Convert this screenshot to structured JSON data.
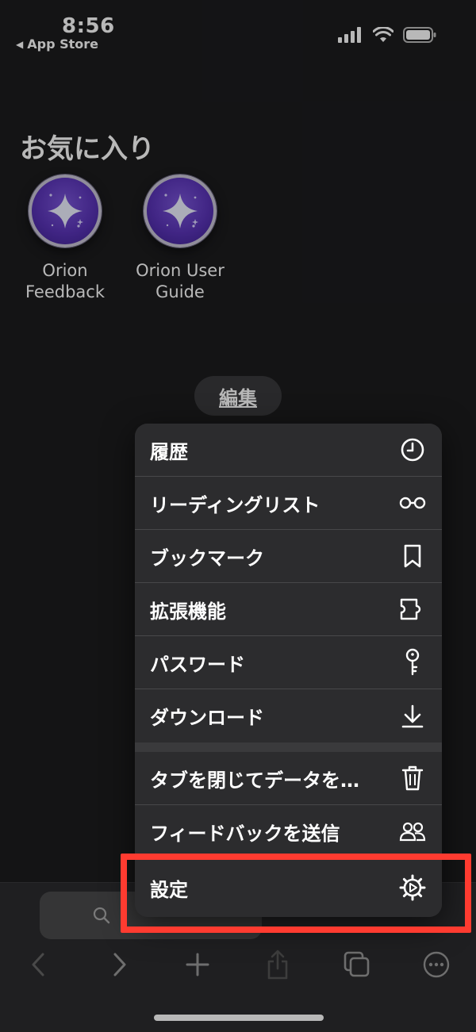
{
  "status": {
    "time": "8:56",
    "back_app": "App Store"
  },
  "favorites": {
    "title": "お気に入り",
    "items": [
      {
        "line1": "Orion",
        "line2": "Feedback",
        "icon": "orion-sparkle-icon"
      },
      {
        "line1": "Orion User",
        "line2": "Guide",
        "icon": "orion-sparkle-icon"
      }
    ]
  },
  "edit_label": "編集",
  "menu": {
    "items": [
      {
        "label": "履歴",
        "icon": "clock-icon"
      },
      {
        "label": "リーディングリスト",
        "icon": "glasses-icon"
      },
      {
        "label": "ブックマーク",
        "icon": "bookmark-icon"
      },
      {
        "label": "拡張機能",
        "icon": "puzzle-icon"
      },
      {
        "label": "パスワード",
        "icon": "key-icon"
      },
      {
        "label": "ダウンロード",
        "icon": "download-icon"
      },
      {
        "label": "タブを閉じてデータを…",
        "icon": "trash-icon"
      },
      {
        "label": "フィードバックを送信",
        "icon": "people-icon"
      },
      {
        "label": "設定",
        "icon": "gear-icon"
      }
    ]
  },
  "colors": {
    "background": "#1c1c1e",
    "menu": "#2c2c2e",
    "highlight": "#ff3b30",
    "orion_purple": "#5a34b8"
  }
}
